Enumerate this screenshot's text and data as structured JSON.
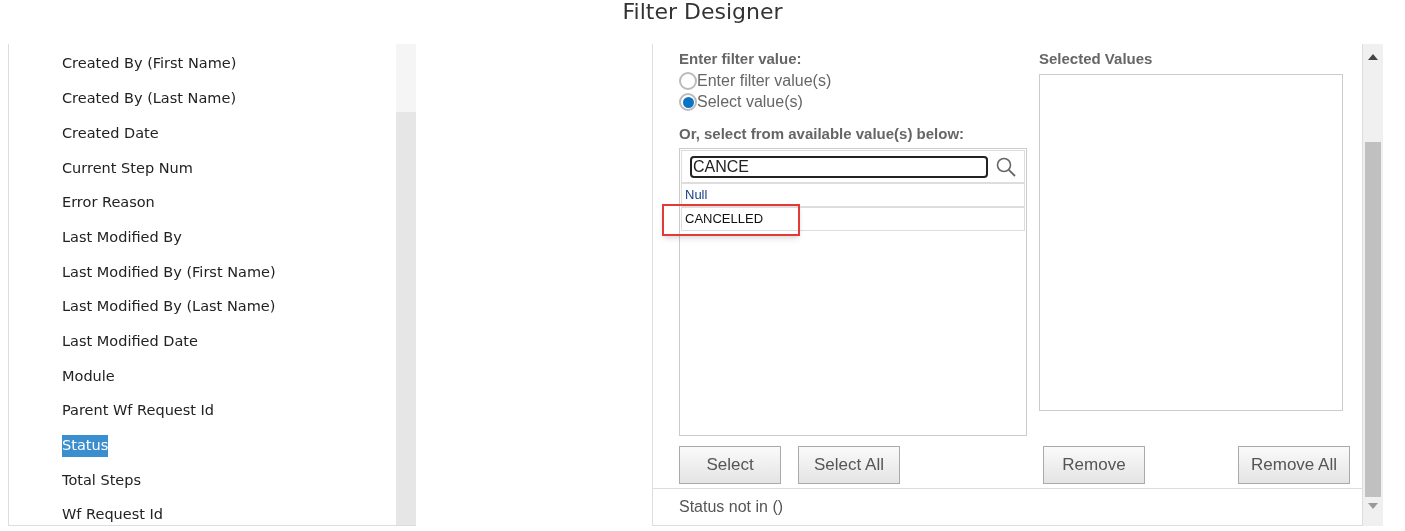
{
  "window": {
    "title": "Filter Designer"
  },
  "fields": [
    {
      "label": "Created By (First Name)",
      "selected": false
    },
    {
      "label": "Created By (Last Name)",
      "selected": false
    },
    {
      "label": "Created Date",
      "selected": false
    },
    {
      "label": "Current Step Num",
      "selected": false
    },
    {
      "label": "Error Reason",
      "selected": false
    },
    {
      "label": "Last Modified By",
      "selected": false
    },
    {
      "label": "Last Modified By (First Name)",
      "selected": false
    },
    {
      "label": "Last Modified By (Last Name)",
      "selected": false
    },
    {
      "label": "Last Modified Date",
      "selected": false
    },
    {
      "label": "Module",
      "selected": false
    },
    {
      "label": "Parent Wf Request Id",
      "selected": false
    },
    {
      "label": "Status",
      "selected": true
    },
    {
      "label": "Total Steps",
      "selected": false
    },
    {
      "label": "Wf Request Id",
      "selected": false
    }
  ],
  "filter": {
    "heading": "Enter filter value:",
    "modes": [
      {
        "label": "Enter filter value(s)",
        "selected": false
      },
      {
        "label": "Select value(s)",
        "selected": true
      }
    ],
    "available_heading": "Or, select from available value(s) below:",
    "search": {
      "value": "CANCE"
    },
    "available_values": [
      {
        "label": "Null",
        "highlighted": false
      },
      {
        "label": "CANCELLED",
        "highlighted": true
      }
    ],
    "selected_heading": "Selected Values",
    "buttons": [
      "Select",
      "Select All",
      "Remove",
      "Remove All"
    ],
    "expression": "Status not in ()"
  }
}
